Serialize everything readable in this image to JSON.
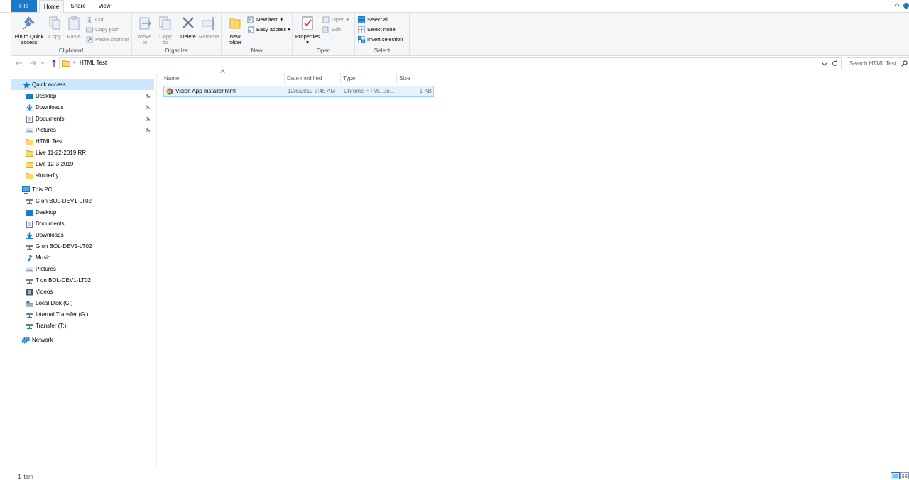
{
  "tabs": {
    "file": "File",
    "home": "Home",
    "share": "Share",
    "view": "View"
  },
  "ribbon": {
    "clipboard": {
      "label": "Clipboard",
      "pin": "Pin to Quick access",
      "copy": "Copy",
      "paste": "Paste",
      "cut": "Cut",
      "copy_path": "Copy path",
      "paste_shortcut": "Paste shortcut"
    },
    "organize": {
      "label": "Organize",
      "move_to": "Move to",
      "copy_to": "Copy to",
      "delete": "Delete",
      "rename": "Rename"
    },
    "new": {
      "label": "New",
      "new_folder": "New folder",
      "new_item": "New item",
      "easy_access": "Easy access"
    },
    "open": {
      "label": "Open",
      "properties": "Properties",
      "open": "Open",
      "edit": "Edit"
    },
    "select": {
      "label": "Select",
      "select_all": "Select all",
      "select_none": "Select none",
      "invert": "Invert selection"
    }
  },
  "address": {
    "path": "HTML Test",
    "search_placeholder": "Search HTML Test"
  },
  "nav": {
    "quick_access": {
      "label": "Quick access",
      "items": [
        "Desktop",
        "Downloads",
        "Documents",
        "Pictures",
        "HTML Test",
        "Live 11-22-2019 RR",
        "Live 12-3-2019",
        "shutterfly"
      ]
    },
    "this_pc": {
      "label": "This PC",
      "items": [
        "C on BOL-DEV1-LT02",
        "Desktop",
        "Documents",
        "Downloads",
        "G on BOL-DEV1-LT02",
        "Music",
        "Pictures",
        "T on BOL-DEV1-LT02",
        "Videos",
        "Local Disk (C:)",
        "Internal Transfer (G:)",
        "Transfer (T:)"
      ]
    },
    "network": {
      "label": "Network"
    }
  },
  "columns": {
    "name": "Name",
    "date": "Date modified",
    "type": "Type",
    "size": "Size"
  },
  "files": [
    {
      "name": "Vision App Installer.html",
      "date": "12/6/2019 7:45 AM",
      "type": "Chrome HTML Do...",
      "size": "1 KB"
    }
  ],
  "status": {
    "count": "1 item"
  },
  "colors": {
    "accent": "#1979ca",
    "selection": "#cce8ff",
    "folder": "#ffd766"
  }
}
